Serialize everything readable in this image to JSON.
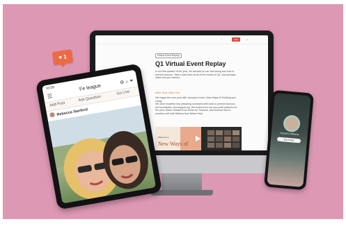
{
  "desktop": {
    "tag": "Virtual Event Replay",
    "title": "Q1 Virtual Event Replay",
    "intro": "In our first quarter of the year, we focused on our well-being and how to prevent burnout. Take a look back at all of the events in Q1, and perhaps catch one you missed.",
    "subheading": "New Year, New You",
    "para1": "We began the new year with January's event, New Ways of Working and Living.",
    "para2": "We dove headfirst into preparing ourselves with tools to prevent burnout, set boundaries, and support joy. We heard from our non-profit partners for the year, Diane Howard from Dress for Success, and learned how to prioritize self with Melissa from Better Help.",
    "video_small": "Welcome to",
    "video_big": "New Ways of",
    "bar_button": "Edit",
    "colors": {
      "accent": "#e56a2c",
      "button": "#e0483c"
    }
  },
  "like_badge": "♥ 1",
  "tablet": {
    "time": "10:05",
    "title": "Fe league",
    "tabs": [
      "Add Post",
      "Ask Question",
      "Go Live"
    ],
    "author": "Rebecca Sanford"
  },
  "phone": {
    "name": "Natasha Williams",
    "button": "Edit Profile"
  },
  "colors": {
    "background": "#dd98b4"
  }
}
